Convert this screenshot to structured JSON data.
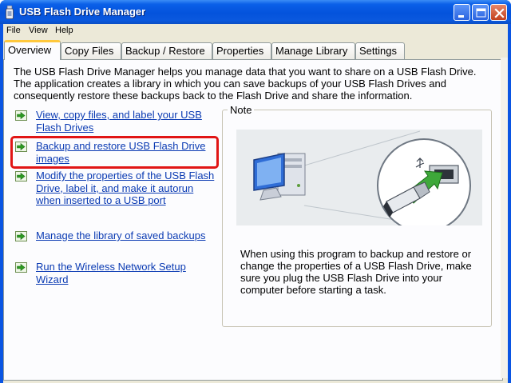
{
  "window": {
    "title": "USB Flash Drive Manager"
  },
  "menu": [
    {
      "label": "File"
    },
    {
      "label": "View"
    },
    {
      "label": "Help"
    }
  ],
  "tabs": [
    {
      "label": "Overview",
      "active": true
    },
    {
      "label": "Copy Files"
    },
    {
      "label": "Backup / Restore"
    },
    {
      "label": "Properties"
    },
    {
      "label": "Manage Library"
    },
    {
      "label": "Settings"
    }
  ],
  "intro": "The USB Flash Drive Manager helps you manage data that you want to share on a USB Flash Drive. The application creates a library in which you can save backups of your USB Flash Drives and consequently restore these backups back to the Flash Drive and share the information.",
  "links": [
    {
      "label": "View, copy files, and label your USB Flash Drives"
    },
    {
      "label": "Backup and restore USB Flash Drive images"
    },
    {
      "label": "Modify the properties of the USB Flash Drive, label it, and make it autorun when inserted to a USB port"
    },
    {
      "label": "Manage the library of saved backups"
    },
    {
      "label": "Run the Wireless Network Setup Wizard"
    }
  ],
  "note": {
    "title": "Note",
    "text": "When using this program to backup and restore or change the properties of a USB Flash Drive, make sure you plug the USB Flash Drive into your computer before starting a task."
  },
  "icons": {
    "link_arrow": "green-arrow-icon",
    "minimize": "minimize-icon",
    "maximize": "maximize-icon",
    "close": "close-icon"
  },
  "colors": {
    "titlebar": "#0a5fe8",
    "link": "#0b3bb3",
    "highlight": "#e11515",
    "active_tab": "#ffc83c"
  }
}
